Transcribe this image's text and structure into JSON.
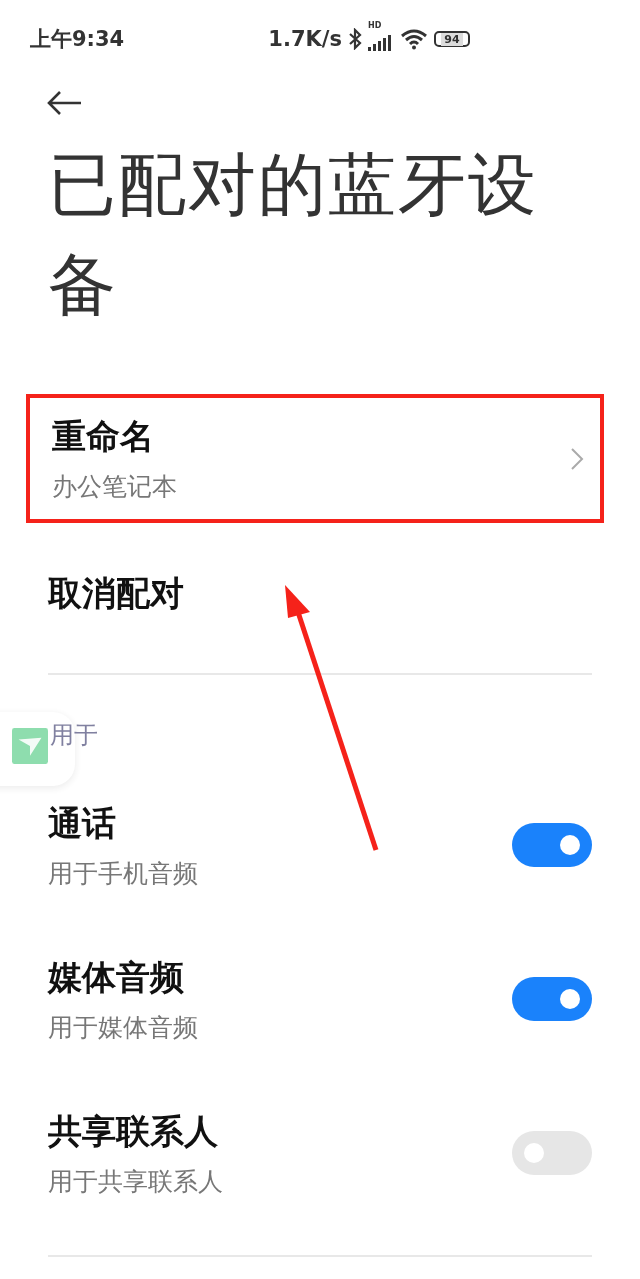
{
  "status_bar": {
    "time": "上午9:34",
    "speed": "1.7K/s",
    "signal_label": "HD",
    "battery": "94"
  },
  "title": "已配对的蓝牙设备",
  "rename": {
    "label": "重命名",
    "value": "办公笔记本",
    "highlighted": true
  },
  "unpair": {
    "label": "取消配对"
  },
  "section_header": "用于",
  "toggles": [
    {
      "label": "通话",
      "description": "用于手机音频",
      "on": true
    },
    {
      "label": "媒体音频",
      "description": "用于媒体音频",
      "on": true
    },
    {
      "label": "共享联系人",
      "description": "用于共享联系人",
      "on": false
    }
  ]
}
